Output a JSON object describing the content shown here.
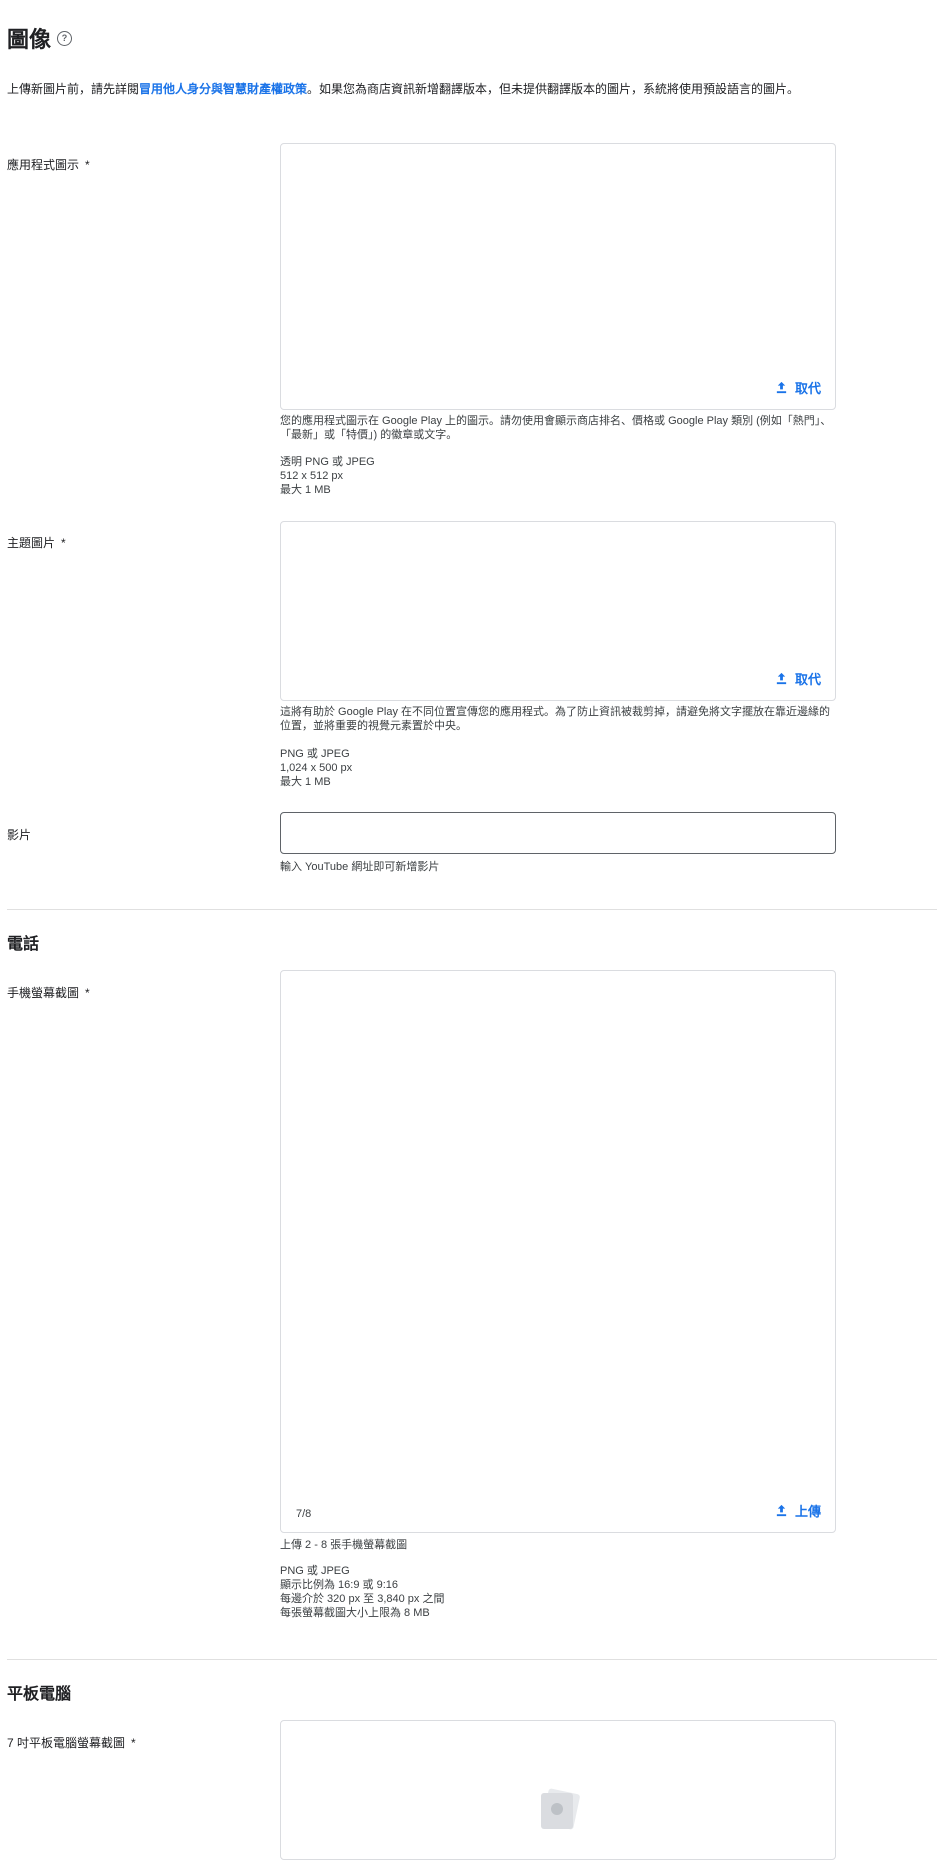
{
  "header": {
    "title": "圖像",
    "help_icon": "help-circle-icon"
  },
  "intro": {
    "text_before": "上傳新圖片前，請先詳閱",
    "link": "冒用他人身分與智慧財產權政策",
    "text_after": "。如果您為商店資訊新增翻譯版本，但未提供翻譯版本的圖片，系統將使用預設語言的圖片。"
  },
  "app_icon": {
    "label": "應用程式圖示",
    "required": "*",
    "action": "取代",
    "helper": "您的應用程式圖示在 Google Play 上的圖示。請勿使用會顯示商店排名、價格或 Google Play 類別 (例如「熱門」、「最新」或「特價」) 的徽章或文字。",
    "spec1": "透明 PNG 或 JPEG",
    "spec2": "512 x 512 px",
    "spec3": "最大 1 MB"
  },
  "feature_graphic": {
    "label": "主題圖片",
    "required": "*",
    "action": "取代",
    "helper": "這將有助於 Google Play 在不同位置宣傳您的應用程式。為了防止資訊被裁剪掉，請避免將文字擺放在靠近邊緣的位置，並將重要的視覺元素置於中央。",
    "spec1": "PNG 或 JPEG",
    "spec2": "1,024 x 500 px",
    "spec3": "最大 1 MB"
  },
  "video": {
    "label": "影片",
    "value": "",
    "helper": "輸入 YouTube 網址即可新增影片"
  },
  "phone": {
    "section_title": "電話",
    "label": "手機螢幕截圖",
    "required": "*",
    "counter": "7/8",
    "action": "上傳",
    "helper": "上傳 2 - 8 張手機螢幕截圖",
    "spec1": "PNG 或 JPEG",
    "spec2": "顯示比例為 16:9 或 9:16",
    "spec3": "每邊介於 320 px 至 3,840 px 之間",
    "spec4": "每張螢幕截圖大小上限為 8 MB"
  },
  "tablet": {
    "section_title": "平板電腦",
    "label": "7 吋平板電腦螢幕截圖",
    "required": "*",
    "placeholder_icon": "image-placeholder-icon"
  },
  "colors": {
    "link": "#1a73e8",
    "border": "#dadce0"
  }
}
